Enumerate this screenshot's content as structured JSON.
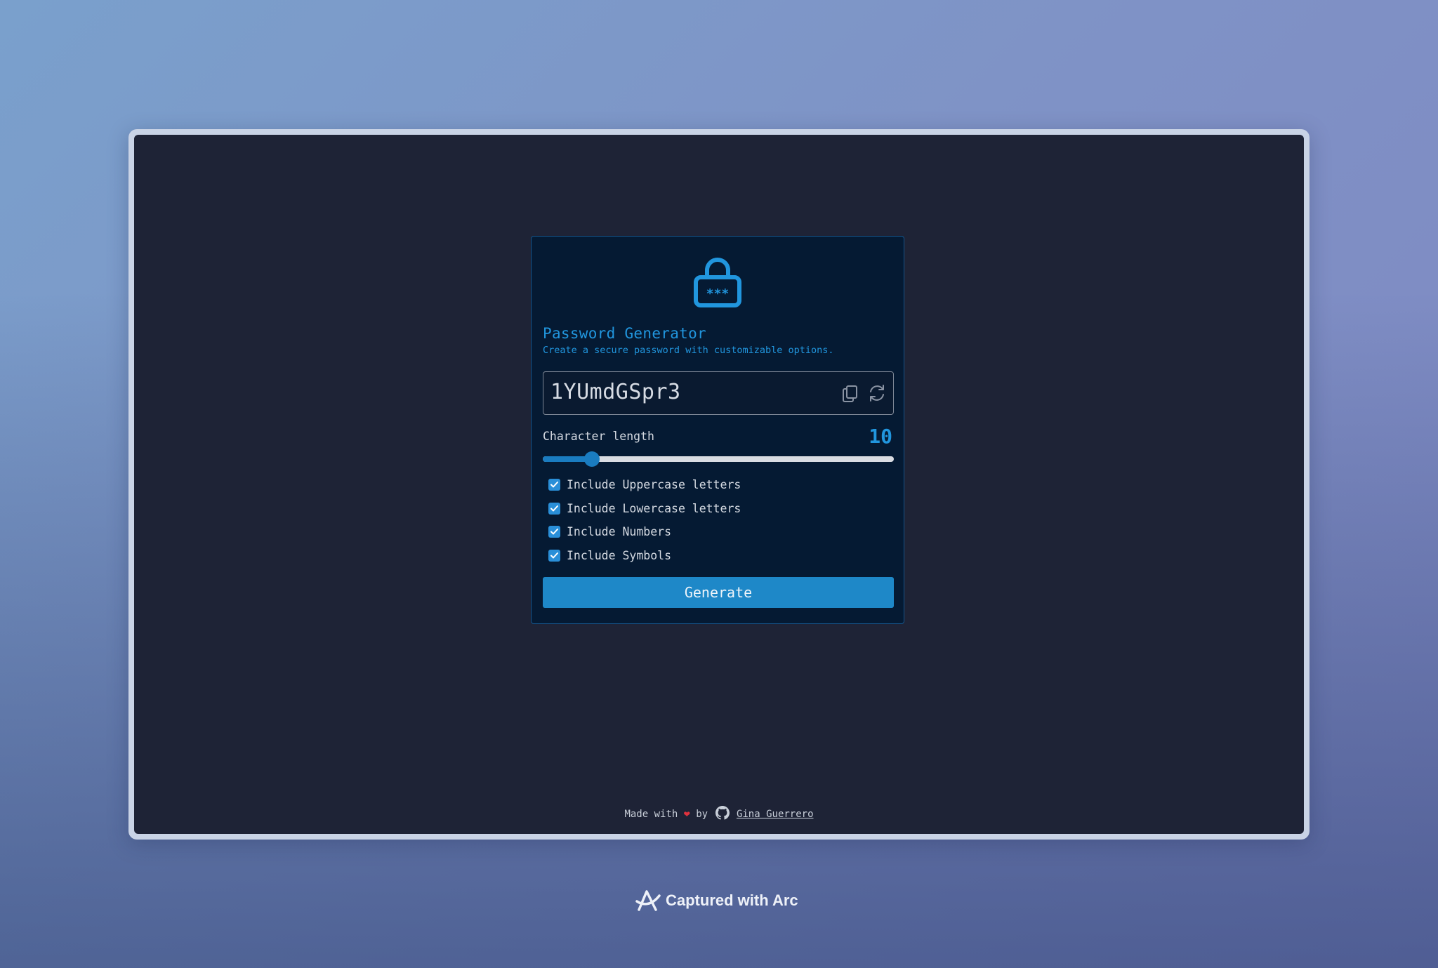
{
  "app": {
    "title": "Password Generator",
    "subtitle": "Create a secure password with customizable options."
  },
  "password": {
    "value": "1YUmdGSpr3",
    "copy_icon": "copy-icon",
    "refresh_icon": "refresh-icon"
  },
  "length": {
    "label": "Character length",
    "value": "10",
    "slider_fraction": 0.14
  },
  "options": [
    {
      "label": "Include Uppercase letters",
      "checked": true
    },
    {
      "label": "Include Lowercase letters",
      "checked": true
    },
    {
      "label": "Include Numbers",
      "checked": true
    },
    {
      "label": "Include Symbols",
      "checked": true
    }
  ],
  "generate_label": "Generate",
  "footer": {
    "made_with": "Made with",
    "by": "by",
    "author": "Gina Guerrero"
  },
  "badge": {
    "text": "Captured with Arc"
  },
  "colors": {
    "accent": "#2196de",
    "button": "#1e88c8",
    "card_bg": "#051a33",
    "window_bg": "#1e2336"
  }
}
